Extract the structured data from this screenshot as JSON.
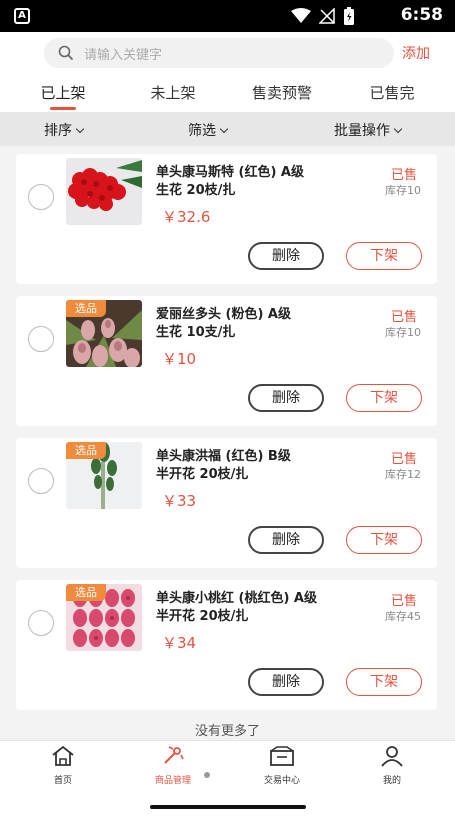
{
  "status_bar": {
    "time": "6:58",
    "notification_icon": "A"
  },
  "header": {
    "search_placeholder": "请输入关键字",
    "add_label": "添加"
  },
  "tabs": [
    {
      "label": "已上架",
      "active": true
    },
    {
      "label": "未上架",
      "active": false
    },
    {
      "label": "售卖预警",
      "active": false
    },
    {
      "label": "已售完",
      "active": false
    }
  ],
  "filters": {
    "sort": "排序",
    "filter": "筛选",
    "batch": "批量操作"
  },
  "products": [
    {
      "name": "单头康马斯特 (红色) A级",
      "spec": "生花 20枝/扎",
      "price": "￥32.6",
      "status": "已售",
      "stock": "库存10",
      "badge": "",
      "delete_label": "删除",
      "offshelf_label": "下架"
    },
    {
      "name": "爱丽丝多头 (粉色) A级",
      "spec": "生花 10支/扎",
      "price": "￥10",
      "status": "已售",
      "stock": "库存10",
      "badge": "选品",
      "delete_label": "删除",
      "offshelf_label": "下架"
    },
    {
      "name": "单头康洪福 (红色) B级",
      "spec": "半开花 20枝/扎",
      "price": "￥33",
      "status": "已售",
      "stock": "库存12",
      "badge": "选品",
      "delete_label": "删除",
      "offshelf_label": "下架"
    },
    {
      "name": "单头康小桃红 (桃红色) A级",
      "spec": "半开花 20枝/扎",
      "price": "￥34",
      "status": "已售",
      "stock": "库存45",
      "badge": "选品",
      "delete_label": "删除",
      "offshelf_label": "下架"
    }
  ],
  "no_more": "没有更多了",
  "bottom_nav": [
    {
      "label": "首页",
      "icon": "home-icon",
      "active": false
    },
    {
      "label": "商品管理",
      "icon": "product-icon",
      "active": true
    },
    {
      "label": "交易中心",
      "icon": "trade-icon",
      "active": false
    },
    {
      "label": "我的",
      "icon": "user-icon",
      "active": false
    }
  ],
  "colors": {
    "accent": "#e5533f",
    "badge": "#f08a3c"
  }
}
